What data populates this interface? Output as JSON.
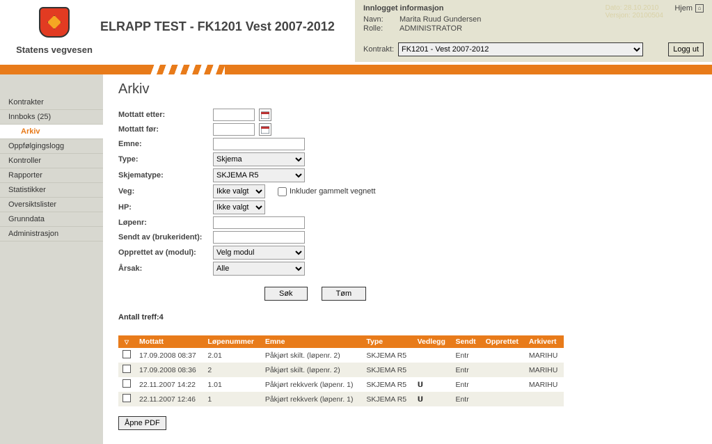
{
  "brand": {
    "text": "Statens vegvesen"
  },
  "app_title": "ELRAPP TEST - FK1201 Vest 2007-2012",
  "top_info": {
    "title": "Innlogget informasjon",
    "name_label": "Navn:",
    "name_value": "Marita Ruud Gundersen",
    "role_label": "Rolle:",
    "role_value": "ADMINISTRATOR",
    "hjem": "Hjem",
    "faded_date": "Dato: 28.10.2010",
    "faded_version": "Versjon:   20100504",
    "kontrakt_label": "Kontrakt:",
    "kontrakt_value": "FK1201 - Vest 2007-2012",
    "logg_ut": "Logg ut"
  },
  "nav": [
    "Kontrakter",
    "Innboks (25)",
    "Arkiv",
    "Oppfølgingslogg",
    "Kontroller",
    "Rapporter",
    "Statistikker",
    "Oversiktslister",
    "Grunndata",
    "Administrasjon"
  ],
  "page_title": "Arkiv",
  "form": {
    "mottatt_etter": "Mottatt etter:",
    "mottatt_for": "Mottatt før:",
    "emne": "Emne:",
    "type": "Type:",
    "type_value": "Skjema",
    "skjematype": "Skjematype:",
    "skjematype_value": "SKJEMA R5",
    "veg": "Veg:",
    "veg_value": "Ikke valgt",
    "inkluder": "Inkluder gammelt vegnett",
    "hp": "HP:",
    "hp_value": "Ikke valgt",
    "lopenr": "Løpenr:",
    "sendt_av": "Sendt av (brukerident):",
    "opprettet_av": "Opprettet av (modul):",
    "opprettet_av_value": "Velg modul",
    "arsak": "Årsak:",
    "arsak_value": "Alle",
    "sok": "Søk",
    "tom": "Tøm"
  },
  "treff_label": "Antall treff:",
  "treff_count": "4",
  "headers": {
    "mottatt": "Mottatt",
    "lopenummer": "Løpenummer",
    "emne": "Emne",
    "type": "Type",
    "vedlegg": "Vedlegg",
    "sendt": "Sendt",
    "opprettet": "Opprettet",
    "arkivert": "Arkivert"
  },
  "rows": [
    {
      "mottatt": "17.09.2008 08:37",
      "lopenummer": "2.01",
      "emne": "Påkjørt skilt. (løpenr. 2)",
      "type": "SKJEMA R5",
      "vedlegg": "",
      "sendt": "Entr",
      "opprettet": "",
      "arkivert": "MARIHU"
    },
    {
      "mottatt": "17.09.2008 08:36",
      "lopenummer": "2",
      "emne": "Påkjørt skilt. (løpenr. 2)",
      "type": "SKJEMA R5",
      "vedlegg": "",
      "sendt": "Entr",
      "opprettet": "",
      "arkivert": "MARIHU"
    },
    {
      "mottatt": "22.11.2007 14:22",
      "lopenummer": "1.01",
      "emne": "Påkjørt rekkverk (løpenr. 1)",
      "type": "SKJEMA R5",
      "vedlegg": "clip",
      "sendt": "Entr",
      "opprettet": "",
      "arkivert": "MARIHU"
    },
    {
      "mottatt": "22.11.2007 12:46",
      "lopenummer": "1",
      "emne": "Påkjørt rekkverk (løpenr. 1)",
      "type": "SKJEMA R5",
      "vedlegg": "clip",
      "sendt": "Entr",
      "opprettet": "",
      "arkivert": ""
    }
  ],
  "open_pdf": "Åpne PDF"
}
